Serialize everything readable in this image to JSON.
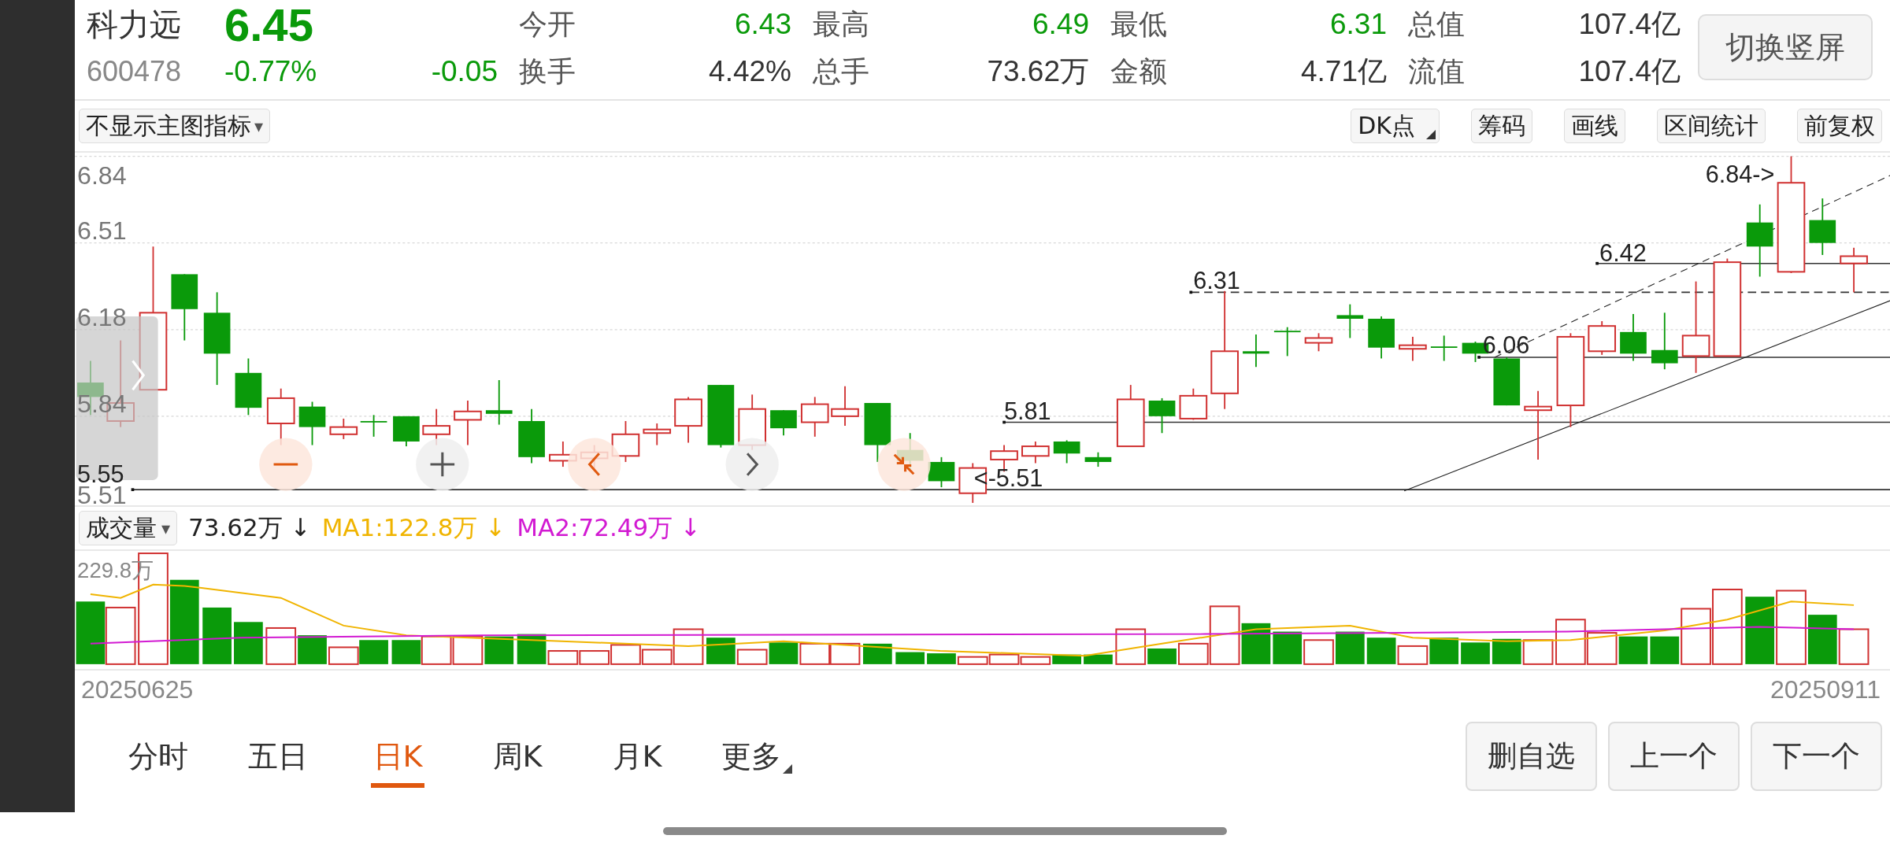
{
  "quote": {
    "name": "科力远",
    "price": "6.45",
    "color": "#0a9a0a",
    "code": "600478",
    "change_pct": "-0.77%",
    "change": "-0.05",
    "stats": [
      {
        "label": "今开",
        "value": "6.43",
        "color": "#0a9a0a"
      },
      {
        "label": "最高",
        "value": "6.49",
        "color": "#0a9a0a"
      },
      {
        "label": "最低",
        "value": "6.31",
        "color": "#0a9a0a"
      },
      {
        "label": "总值",
        "value": "107.4亿",
        "color": "#333333"
      },
      {
        "label": "换手",
        "value": "4.42%",
        "color": "#333333"
      },
      {
        "label": "总手",
        "value": "73.62万",
        "color": "#333333"
      },
      {
        "label": "金额",
        "value": "4.71亿",
        "color": "#333333"
      },
      {
        "label": "流值",
        "value": "107.4亿",
        "color": "#333333"
      }
    ]
  },
  "switch_button": "切换竖屏",
  "indicator_menu": {
    "label": "不显示主图指标",
    "caret": "▾"
  },
  "tools": [
    {
      "label": "DK点",
      "menu": true
    },
    {
      "label": "筹码",
      "menu": false
    },
    {
      "label": "画线",
      "menu": false
    },
    {
      "label": "区间统计",
      "menu": false
    },
    {
      "label": "前复权",
      "menu": false
    }
  ],
  "price_axis": [
    "6.84",
    "6.51",
    "6.18",
    "5.84",
    "5.51"
  ],
  "annotations": [
    "6.31",
    "5.81",
    "6.06",
    "6.42",
    "6.84->",
    "<-5.51",
    "5.55"
  ],
  "volume": {
    "menu": "成交量",
    "caret": "▾",
    "axis_max": "229.8万",
    "readings": [
      {
        "text": "73.62万 ↓",
        "color": "#222222"
      },
      {
        "text": "MA1:122.8万 ↓",
        "color": "#f0b400"
      },
      {
        "text": "MA2:72.49万 ↓",
        "color": "#d21ad2"
      }
    ]
  },
  "dates": [
    "20250625",
    "20250911"
  ],
  "period_tabs": [
    {
      "label": "分时",
      "selected": false,
      "menu": false
    },
    {
      "label": "五日",
      "selected": false,
      "menu": false
    },
    {
      "label": "日K",
      "selected": true,
      "menu": false
    },
    {
      "label": "周K",
      "selected": false,
      "menu": false
    },
    {
      "label": "月K",
      "selected": false,
      "menu": false
    },
    {
      "label": "更多",
      "selected": false,
      "menu": true
    }
  ],
  "actions": [
    "删自选",
    "上一个",
    "下一个"
  ]
}
